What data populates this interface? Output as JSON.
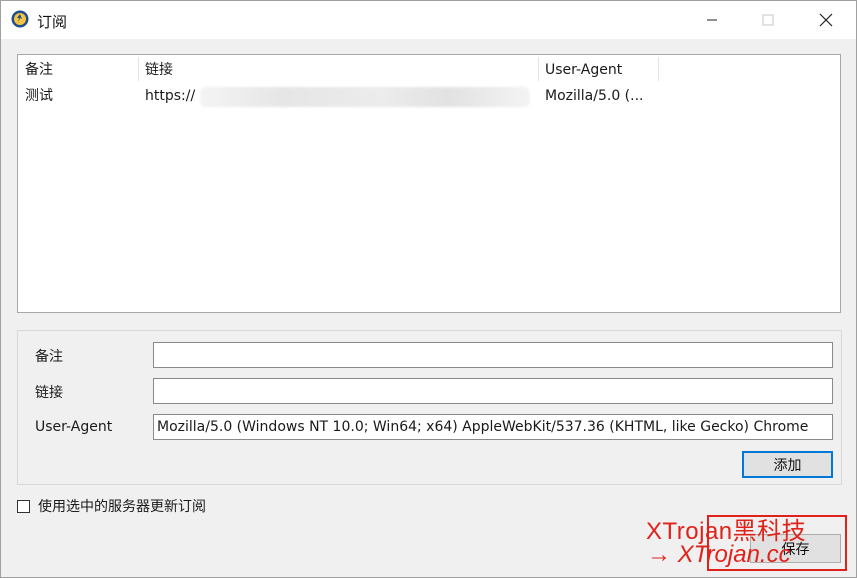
{
  "window": {
    "title": "订阅",
    "controls": [
      "minimize-icon",
      "maximize-icon",
      "close-icon"
    ]
  },
  "list": {
    "columns": [
      "备注",
      "链接",
      "User-Agent"
    ],
    "rows": [
      {
        "remark": "测试",
        "link": "https://",
        "user_agent": "Mozilla/5.0 (..."
      }
    ]
  },
  "form": {
    "remark_label": "备注",
    "remark_value": "",
    "link_label": "链接",
    "link_value": "",
    "ua_label": "User-Agent",
    "ua_value": "Mozilla/5.0 (Windows NT 10.0; Win64; x64) AppleWebKit/537.36 (KHTML, like Gecko) Chrome",
    "add_label": "添加"
  },
  "options": {
    "update_with_selected_server_label": "使用选中的服务器更新订阅",
    "update_with_selected_server_checked": false
  },
  "footer": {
    "save_label": "保存"
  },
  "watermark": {
    "line1": "XTrojan黑科技",
    "line2": "→ XTrojan.cc"
  },
  "colors": {
    "accent": "#0078d7",
    "window_bg": "#f0f0f0",
    "watermark": "#e0231a"
  }
}
